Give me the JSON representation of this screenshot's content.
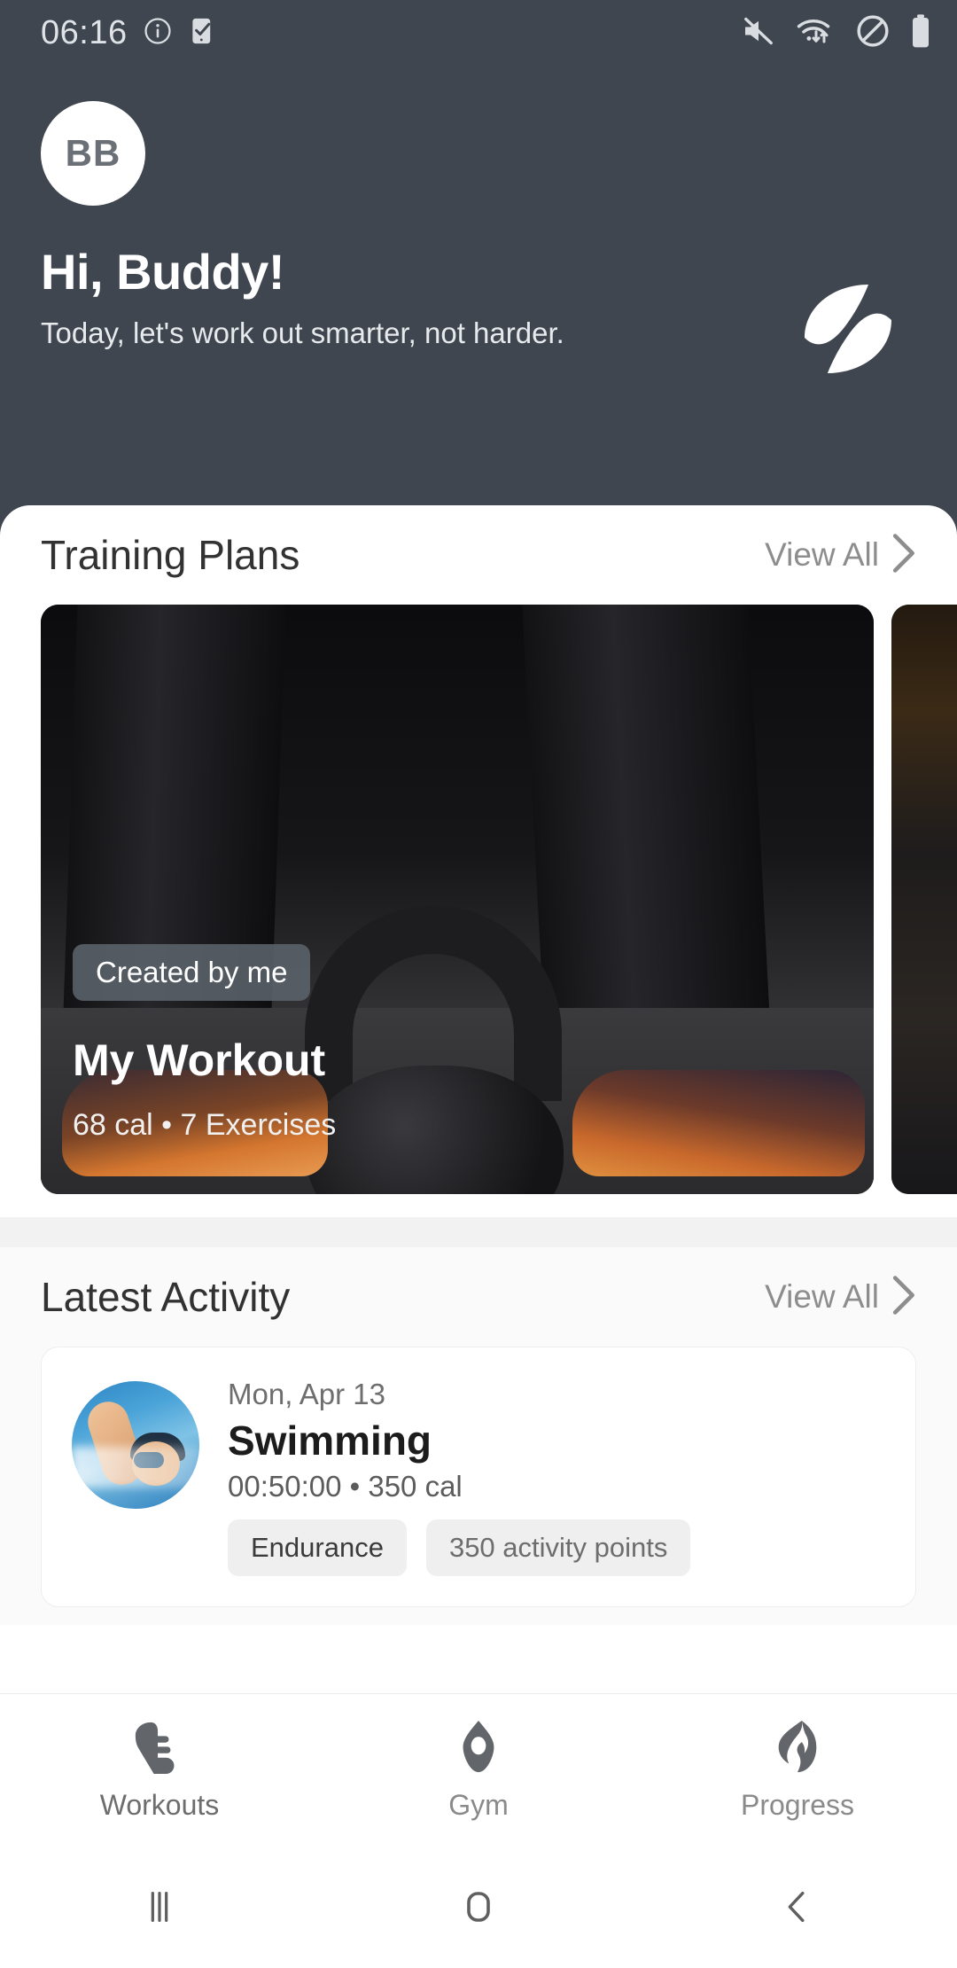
{
  "status_bar": {
    "time": "06:16",
    "left_icons": [
      "info-circle-icon",
      "phone-check-icon"
    ],
    "right_icons": [
      "mute-icon",
      "wifi-data-icon",
      "do-not-disturb-icon",
      "battery-icon"
    ]
  },
  "header": {
    "avatar_initials": "BB",
    "greeting": "Hi, Buddy!",
    "subtitle": "Today, let's work out smarter, not harder.",
    "logo_name": "leaf-logo",
    "background_color": "#3f464f"
  },
  "training_plans": {
    "title": "Training Plans",
    "view_all_label": "View All",
    "cards": [
      {
        "badge": "Created by me",
        "title": "My Workout",
        "meta": "68 cal • 7 Exercises",
        "image_name": "kettlebell-photo"
      },
      {
        "image_name": "gym-photo-partial"
      }
    ]
  },
  "latest_activity": {
    "title": "Latest Activity",
    "view_all_label": "View All",
    "items": [
      {
        "date": "Mon, Apr 13",
        "title": "Swimming",
        "meta": "00:50:00 • 350 cal",
        "thumb_name": "swimming-photo",
        "tags": [
          "Endurance",
          "350 activity points"
        ]
      }
    ]
  },
  "bottom_nav": {
    "items": [
      {
        "label": "Workouts",
        "icon": "shoe-icon"
      },
      {
        "label": "Gym",
        "icon": "dumbbell-icon"
      },
      {
        "label": "Progress",
        "icon": "flame-icon"
      }
    ]
  },
  "system_nav": {
    "recents": "recents-icon",
    "home": "home-icon",
    "back": "back-icon"
  }
}
